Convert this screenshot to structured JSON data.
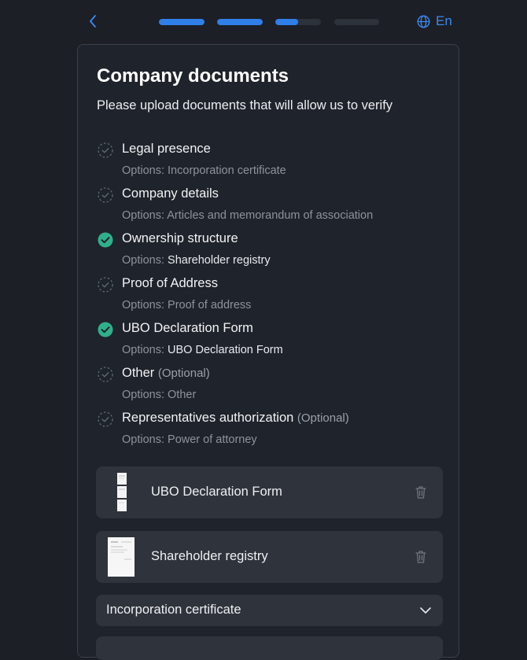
{
  "header": {
    "language_label": "En",
    "steps": [
      {
        "progress": 1.0
      },
      {
        "progress": 1.0
      },
      {
        "progress": 0.5
      },
      {
        "progress": 0.0
      }
    ],
    "accent_color": "#2f7fe8"
  },
  "card": {
    "title": "Company documents",
    "subtitle": "Please upload documents that will allow us to verify"
  },
  "requirements": [
    {
      "name": "Legal presence",
      "optional_label": "",
      "options_prefix": "Options:",
      "options_value": "Incorporation certificate",
      "status": "pending"
    },
    {
      "name": "Company details",
      "optional_label": "",
      "options_prefix": "Options:",
      "options_value": "Articles and memorandum of association",
      "status": "pending"
    },
    {
      "name": "Ownership structure",
      "optional_label": "",
      "options_prefix": "Options:",
      "options_value": "Shareholder registry",
      "status": "done"
    },
    {
      "name": "Proof of Address",
      "optional_label": "",
      "options_prefix": "Options:",
      "options_value": "Proof of address",
      "status": "pending"
    },
    {
      "name": "UBO Declaration Form",
      "optional_label": "",
      "options_prefix": "Options:",
      "options_value": "UBO Declaration Form",
      "status": "done"
    },
    {
      "name": "Other",
      "optional_label": "(Optional)",
      "options_prefix": "Options:",
      "options_value": "Other",
      "status": "pending"
    },
    {
      "name": "Representatives authorization",
      "optional_label": "(Optional)",
      "options_prefix": "Options:",
      "options_value": "Power of attorney",
      "status": "pending"
    }
  ],
  "uploaded_files": [
    {
      "name": "UBO Declaration Form",
      "thumb": "multi-page-document"
    },
    {
      "name": "Shareholder registry",
      "thumb": "single-page-document"
    }
  ],
  "document_selector": {
    "label": "Incorporation certificate",
    "icon": "chevron-down-icon"
  },
  "colors": {
    "done_check": "#2fb08a",
    "pending_check": "#5c6b66"
  }
}
